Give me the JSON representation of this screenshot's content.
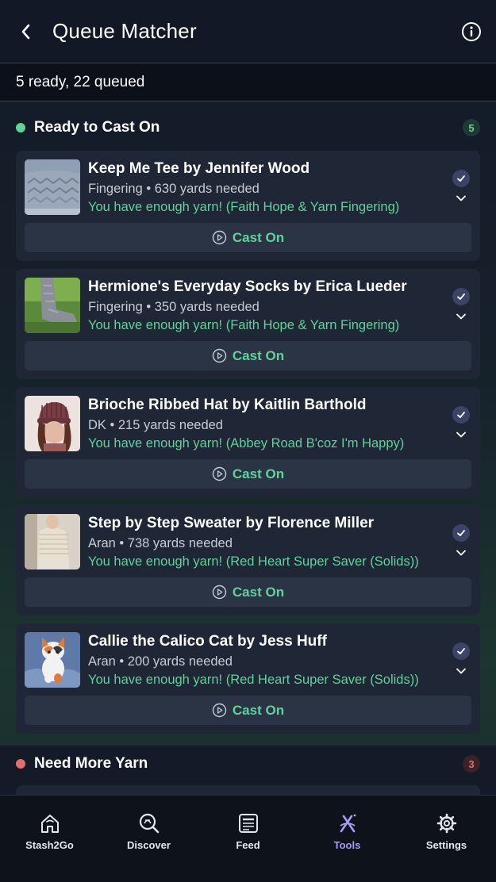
{
  "header": {
    "title": "Queue Matcher",
    "back_icon": "chevron-left-icon",
    "info_icon": "info-icon"
  },
  "summary": {
    "text": "5 ready, 22 queued"
  },
  "colors": {
    "accent_green": "#5fd39a",
    "accent_red": "#e36e6e",
    "active_tab": "#a99cf6"
  },
  "sections": {
    "ready": {
      "title": "Ready to Cast On",
      "count": "5",
      "items": [
        {
          "title": "Keep Me Tee by Jennifer Wood",
          "meta": "Fingering • 630 yards needed",
          "status": "You have enough yarn! (Faith Hope & Yarn Fingering)",
          "action": "Cast On"
        },
        {
          "title": "Hermione's Everyday Socks by Erica Lueder",
          "meta": "Fingering • 350 yards needed",
          "status": "You have enough yarn! (Faith Hope & Yarn Fingering)",
          "action": "Cast On"
        },
        {
          "title": "Brioche Ribbed Hat by Kaitlin Barthold",
          "meta": "DK • 215 yards needed",
          "status": "You have enough yarn! (Abbey Road B'coz I'm Happy)",
          "action": "Cast On"
        },
        {
          "title": "Step by Step Sweater by Florence Miller",
          "meta": "Aran • 738 yards needed",
          "status": "You have enough yarn! (Red Heart Super Saver (Solids))",
          "action": "Cast On"
        },
        {
          "title": "Callie the Calico Cat by Jess Huff",
          "meta": "Aran • 200 yards needed",
          "status": "You have enough yarn! (Red Heart Super Saver (Solids))",
          "action": "Cast On"
        }
      ]
    },
    "need": {
      "title": "Need More Yarn",
      "count": "3"
    }
  },
  "tabs": [
    {
      "label": "Stash2Go",
      "icon": "home-icon"
    },
    {
      "label": "Discover",
      "icon": "discover-icon"
    },
    {
      "label": "Feed",
      "icon": "feed-icon"
    },
    {
      "label": "Tools",
      "icon": "tools-icon",
      "active": true
    },
    {
      "label": "Settings",
      "icon": "gear-icon"
    }
  ]
}
